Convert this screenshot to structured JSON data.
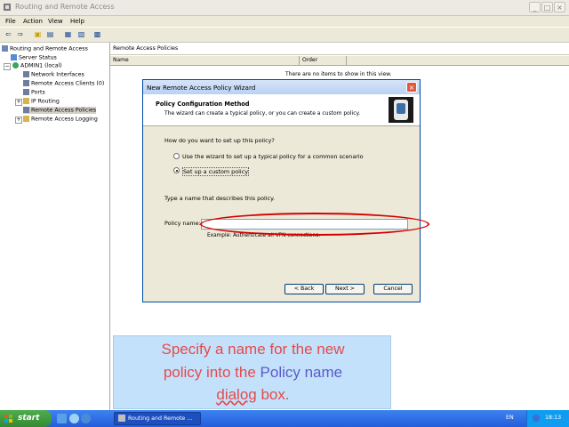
{
  "window": {
    "title": "Routing and Remote Access"
  },
  "menu": [
    "File",
    "Action",
    "View",
    "Help"
  ],
  "tree": {
    "root": "Routing and Remote Access",
    "server_status": "Server Status",
    "server": "ADMIN1 (local)",
    "items": [
      "Network Interfaces",
      "Remote Access Clients (0)",
      "Ports",
      "IP Routing",
      "Remote Access Policies",
      "Remote Access Logging"
    ]
  },
  "right_pane": {
    "header": "Remote Access Policies",
    "columns": [
      "Name",
      "Order"
    ],
    "empty_message": "There are no items to show in this view."
  },
  "dialog": {
    "title": "New Remote Access Policy Wizard",
    "heading": "Policy Configuration Method",
    "subheading": "The wizard can create a typical policy, or you can create a custom policy.",
    "question": "How do you want to set up this policy?",
    "option_typical": "Use the wizard to set up a typical policy for a common scenario",
    "option_custom": "Set up a custom policy",
    "name_prompt": "Type a name that describes this policy.",
    "policy_name_label": "Policy name:",
    "policy_name_value": "",
    "example": "Example: Authenticate all VPN connections.",
    "back": "< Back",
    "next": "Next >",
    "cancel": "Cancel"
  },
  "caption": {
    "line1": "Specify a name for the new",
    "line2_pre": "policy into the ",
    "line2_highlight": "Policy name",
    "line3_word": "dialog",
    "line3_rest": " box."
  },
  "taskbar": {
    "start": "start",
    "task": "Routing and Remote ...",
    "language": "EN",
    "clock": "18:13"
  },
  "colors": {
    "highlight_oval": "#d40000",
    "caption_text": "#e34b4b",
    "caption_blue": "#5a5ac9"
  }
}
